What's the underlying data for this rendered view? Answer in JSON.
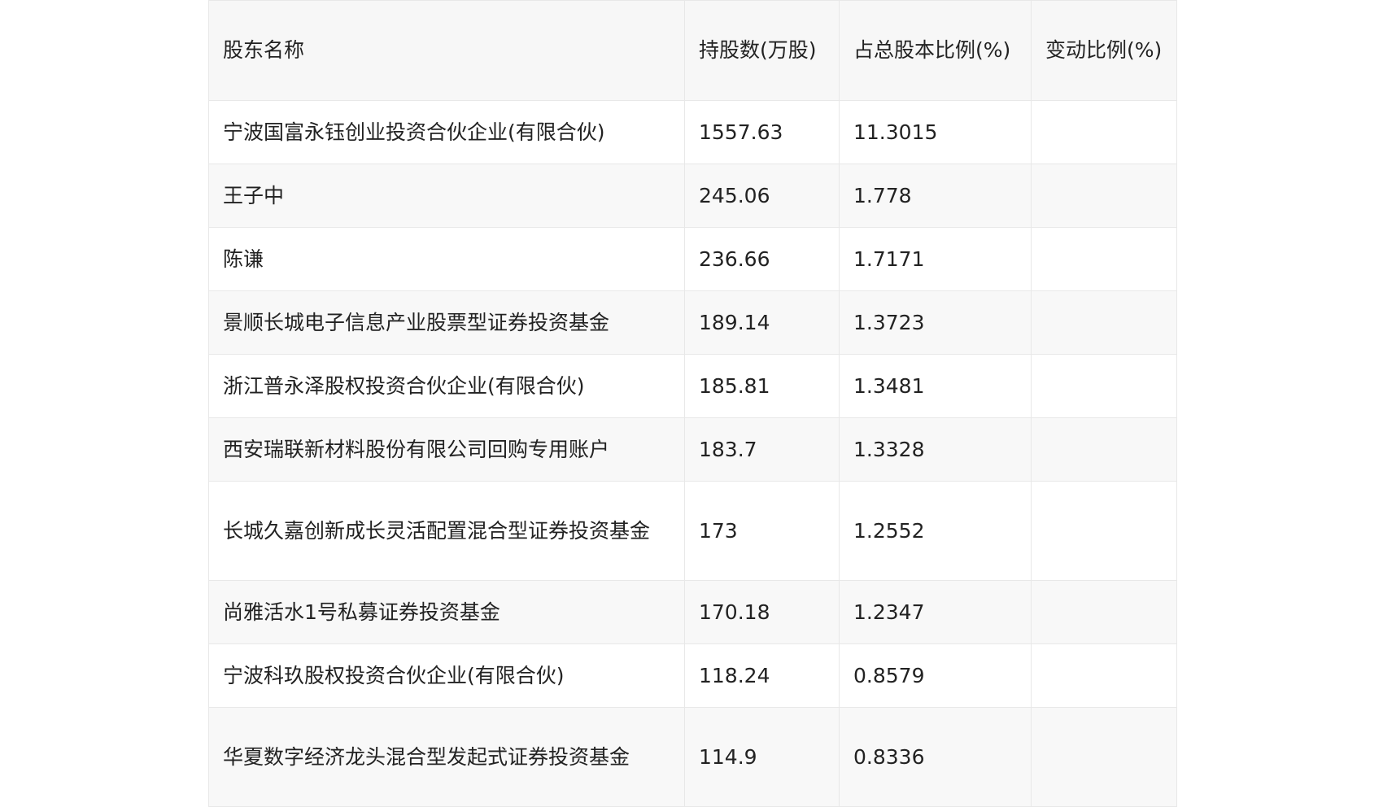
{
  "table": {
    "headers": {
      "name": "股东名称",
      "shares": "持股数(万股)",
      "ratio": "占总股本比例(%)",
      "change": "变动比例(%)"
    },
    "rows": [
      {
        "name": "宁波国富永钰创业投资合伙企业(有限合伙)",
        "shares": "1557.63",
        "ratio": "11.3015",
        "change": ""
      },
      {
        "name": "王子中",
        "shares": "245.06",
        "ratio": "1.778",
        "change": ""
      },
      {
        "name": "陈谦",
        "shares": "236.66",
        "ratio": "1.7171",
        "change": ""
      },
      {
        "name": "景顺长城电子信息产业股票型证券投资基金",
        "shares": "189.14",
        "ratio": "1.3723",
        "change": ""
      },
      {
        "name": "浙江普永泽股权投资合伙企业(有限合伙)",
        "shares": "185.81",
        "ratio": "1.3481",
        "change": ""
      },
      {
        "name": "西安瑞联新材料股份有限公司回购专用账户",
        "shares": "183.7",
        "ratio": "1.3328",
        "change": ""
      },
      {
        "name": "长城久嘉创新成长灵活配置混合型证券投资基金",
        "shares": "173",
        "ratio": "1.2552",
        "change": ""
      },
      {
        "name": "尚雅活水1号私募证券投资基金",
        "shares": "170.18",
        "ratio": "1.2347",
        "change": ""
      },
      {
        "name": "宁波科玖股权投资合伙企业(有限合伙)",
        "shares": "118.24",
        "ratio": "0.8579",
        "change": ""
      },
      {
        "name": "华夏数字经济龙头混合型发起式证券投资基金",
        "shares": "114.9",
        "ratio": "0.8336",
        "change": ""
      }
    ]
  }
}
